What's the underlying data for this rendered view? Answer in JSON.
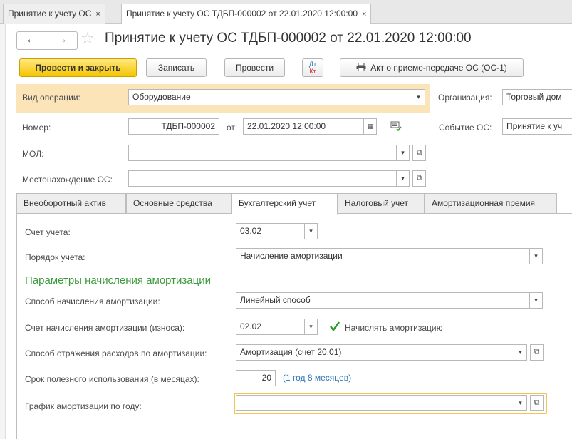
{
  "window_tabs": [
    {
      "label": "Принятие к учету ОС",
      "close": "×"
    },
    {
      "label": "Принятие к учету ОС ТДБП-000002 от 22.01.2020 12:00:00",
      "close": "×"
    }
  ],
  "title": "Принятие к учету ОС ТДБП-000002 от 22.01.2020 12:00:00",
  "toolbar": {
    "post_close": "Провести и закрыть",
    "save": "Записать",
    "post": "Провести",
    "dtkt_top": "Дт",
    "dtkt_bottom": "Кт",
    "act": "Акт о приеме-передаче ОС (ОС-1)"
  },
  "form": {
    "operation_label": "Вид операции:",
    "operation_value": "Оборудование",
    "org_label": "Организация:",
    "org_value": "Торговый дом",
    "number_label": "Номер:",
    "number_value": "ТДБП-000002",
    "date_label": "от:",
    "date_value": "22.01.2020 12:00:00",
    "event_label": "Событие ОС:",
    "event_value": "Принятие к уч",
    "mol_label": "МОЛ:",
    "mol_value": "",
    "location_label": "Местонахождение ОС:",
    "location_value": ""
  },
  "tabs": [
    "Внеоборотный актив",
    "Основные средства",
    "Бухгалтерский учет",
    "Налоговый учет",
    "Амортизационная премия"
  ],
  "active_tab": "Бухгалтерский учет",
  "accounting": {
    "account_label": "Счет учета:",
    "account_value": "03.02",
    "order_label": "Порядок учета:",
    "order_value": "Начисление амортизации",
    "section_title": "Параметры начисления амортизации",
    "method_label": "Способ начисления амортизации:",
    "method_value": "Линейный способ",
    "depr_account_label": "Счет начисления амортизации (износа):",
    "depr_account_value": "02.02",
    "accrue_label": "Начислять амортизацию",
    "accrue_checked": true,
    "expense_label": "Способ отражения расходов по амортизации:",
    "expense_value": "Амортизация (счет 20.01)",
    "life_label": "Срок полезного использования (в месяцах):",
    "life_value": "20",
    "life_hint": "(1 год 8 месяцев)",
    "schedule_label": "График амортизации по году:",
    "schedule_value": ""
  },
  "colors": {
    "accent_yellow": "#f5c500",
    "section_green": "#3a9a3a",
    "link_blue": "#2b73b8",
    "panel_orange": "#fae4b8"
  }
}
